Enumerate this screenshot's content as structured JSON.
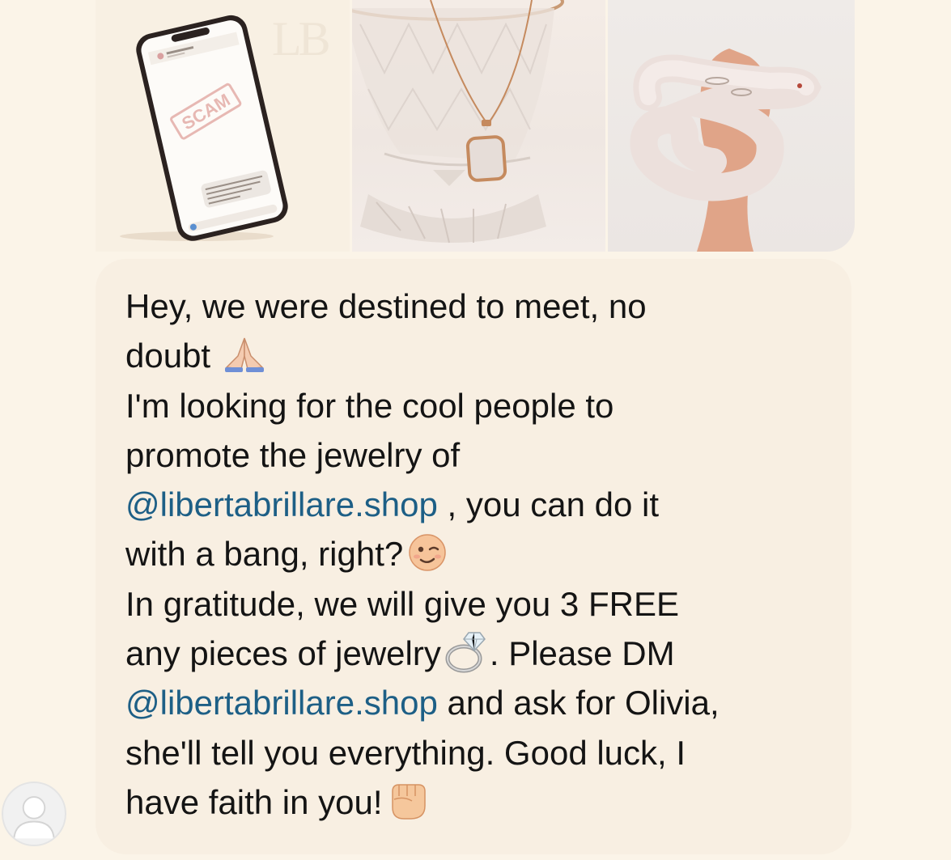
{
  "images": {
    "tile1": {
      "description": "phone-showing-scam-message",
      "stamp": "SCAM",
      "watermark": "LB"
    },
    "tile2": {
      "description": "necklace-on-crystal-glass"
    },
    "tile3": {
      "description": "hand-holding-white-snake"
    }
  },
  "message": {
    "line1": "Hey, we were destined to meet, no",
    "line2": "doubt ",
    "line3": "I'm looking for the cool people to",
    "line4": "promote the jewelry of",
    "mention1": "@libertabrillare.shop",
    "line5_rest": " , you can do it",
    "line6": "with a bang, right?",
    "line7": "In gratitude, we will give you 3 FREE",
    "line8a": "any pieces of jewelry",
    "line8b": ". Please DM",
    "mention2": "@libertabrillare.shop",
    "line9_rest": " and ask for Olivia,",
    "line10": "she'll tell you everything. Good luck, I",
    "line11": "have faith in you!"
  },
  "emojis": [
    "folded-hands-emoji",
    "winking-face-emoji",
    "ring-emoji",
    "raised-fist-emoji"
  ],
  "colors": {
    "background": "#fbf4e8",
    "bubble": "#f8efe2",
    "mention": "#1d5f86",
    "text": "#141414"
  }
}
